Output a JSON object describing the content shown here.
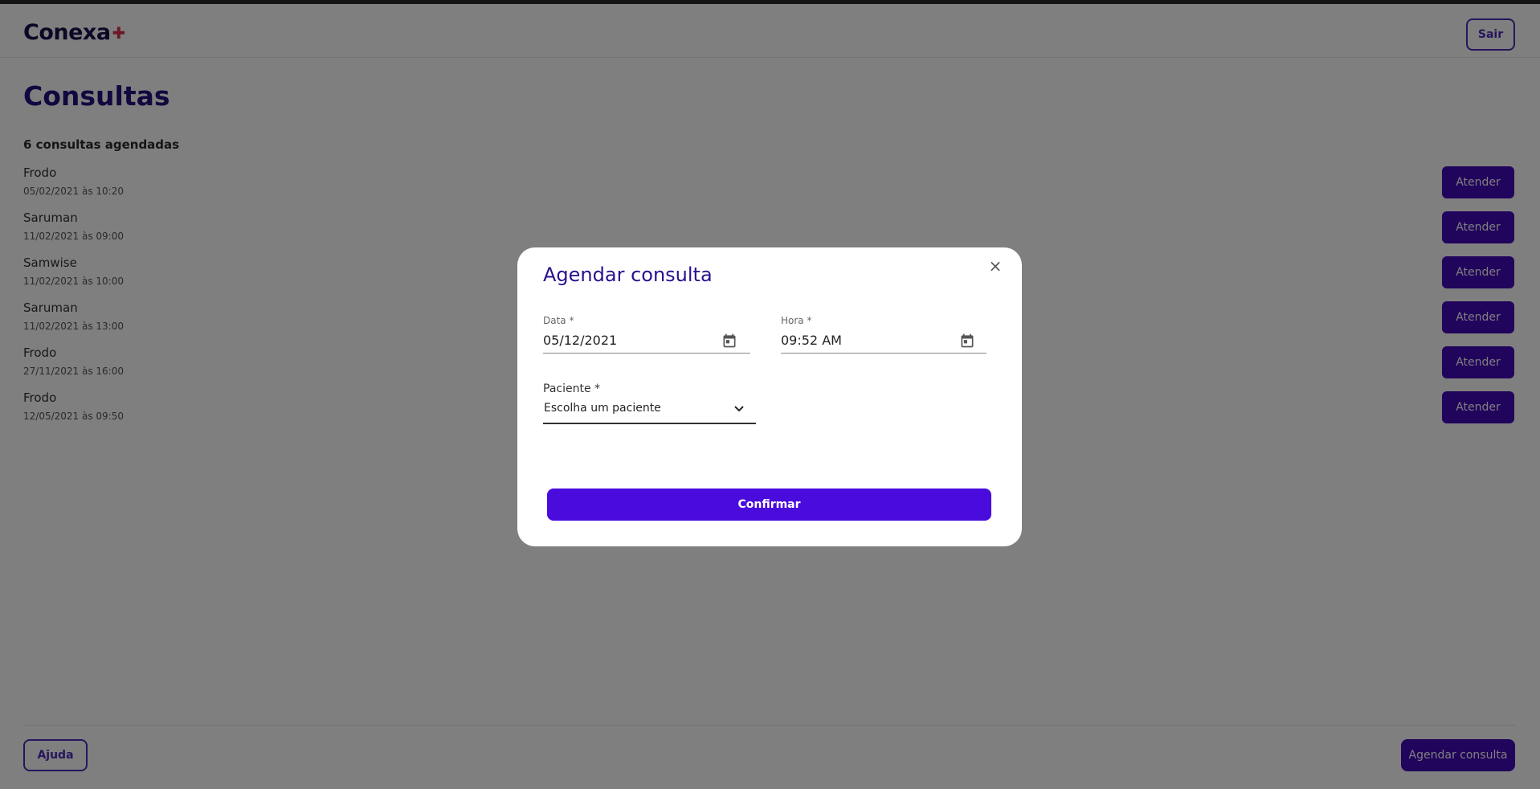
{
  "header": {
    "logo_text": "Conexa",
    "logo_mark": "✚",
    "logout_label": "Sair"
  },
  "main": {
    "title": "Consultas",
    "count_label": "6 consultas agendadas",
    "appointments": [
      {
        "name": "Frodo",
        "when": "05/02/2021 às 10:20",
        "action": "Atender"
      },
      {
        "name": "Saruman",
        "when": "11/02/2021 às 09:00",
        "action": "Atender"
      },
      {
        "name": "Samwise",
        "when": "11/02/2021 às 10:00",
        "action": "Atender"
      },
      {
        "name": "Saruman",
        "when": "11/02/2021 às 13:00",
        "action": "Atender"
      },
      {
        "name": "Frodo",
        "when": "27/11/2021 às 16:00",
        "action": "Atender"
      },
      {
        "name": "Frodo",
        "when": "12/05/2021 às 09:50",
        "action": "Atender"
      }
    ]
  },
  "footer": {
    "help_label": "Ajuda",
    "schedule_label": "Agendar consulta"
  },
  "modal": {
    "title": "Agendar consulta",
    "close_icon": "×",
    "date": {
      "label": "Data *",
      "value": "05/12/2021"
    },
    "time": {
      "label": "Hora *",
      "value": "09:52 AM"
    },
    "patient": {
      "label": "Paciente *",
      "selected": "Escolha um paciente"
    },
    "confirm_label": "Confirmar"
  },
  "colors": {
    "brand_primary": "#4308b8",
    "confirm_button": "#4a0bdd",
    "title_color": "#250f7e",
    "logo_accent": "#d9334a",
    "overlay": "rgba(0,0,0,0.5)"
  }
}
